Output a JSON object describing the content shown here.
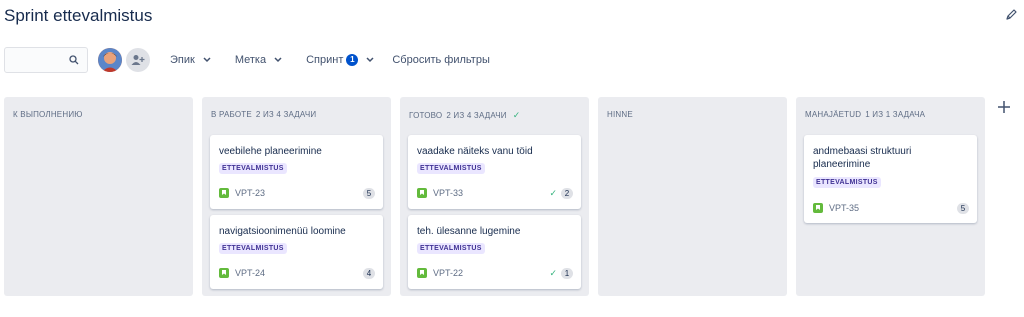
{
  "page": {
    "title": "Sprint ettevalmistus"
  },
  "toolbar": {
    "search_placeholder": "",
    "filters": {
      "epic": "Эпик",
      "label": "Метка",
      "sprint": "Спринт",
      "sprint_badge": "1"
    },
    "reset": "Сбросить фильтры"
  },
  "columns": [
    {
      "title": "К ВЫПОЛНЕНИЮ",
      "count": "",
      "cards": []
    },
    {
      "title": "В РАБОТЕ",
      "count": "2 ИЗ 4 ЗАДАЧИ",
      "cards": [
        {
          "title": "veebilehe planeerimine",
          "epic": "ETTEVALMISTUS",
          "key": "VPT-23",
          "points": "5",
          "done": false
        },
        {
          "title": "navigatsioonimenüü loomine",
          "epic": "ETTEVALMISTUS",
          "key": "VPT-24",
          "points": "4",
          "done": false
        }
      ]
    },
    {
      "title": "ГОТОВО",
      "count": "2 ИЗ 4 ЗАДАЧИ",
      "cards": [
        {
          "title": "vaadake näiteks vanu töid",
          "epic": "ETTEVALMISTUS",
          "key": "VPT-33",
          "points": "2",
          "done": true
        },
        {
          "title": "teh. ülesanne lugemine",
          "epic": "ETTEVALMISTUS",
          "key": "VPT-22",
          "points": "1",
          "done": true
        }
      ]
    },
    {
      "title": "HINNE",
      "count": "",
      "cards": []
    },
    {
      "title": "MAHAJÄETUD",
      "count": "1 ИЗ 1 ЗАДАЧА",
      "cards": [
        {
          "title": "andmebaasi struktuuri planeerimine",
          "epic": "ETTEVALMISTUS",
          "key": "VPT-35",
          "points": "5",
          "done": false
        }
      ]
    }
  ],
  "colors": {
    "column_bg": "#ebecf0",
    "epic_bg": "#eae6ff",
    "epic_text": "#403294",
    "story": "#63ba3c",
    "done": "#36b37e",
    "badge": "#0052cc"
  },
  "icons": {
    "edit": "pencil-icon",
    "search": "search-icon",
    "add_user": "add-user-icon",
    "chevron": "chevron-down-icon",
    "story": "story-icon",
    "check": "check-icon",
    "add_column": "plus-icon"
  }
}
